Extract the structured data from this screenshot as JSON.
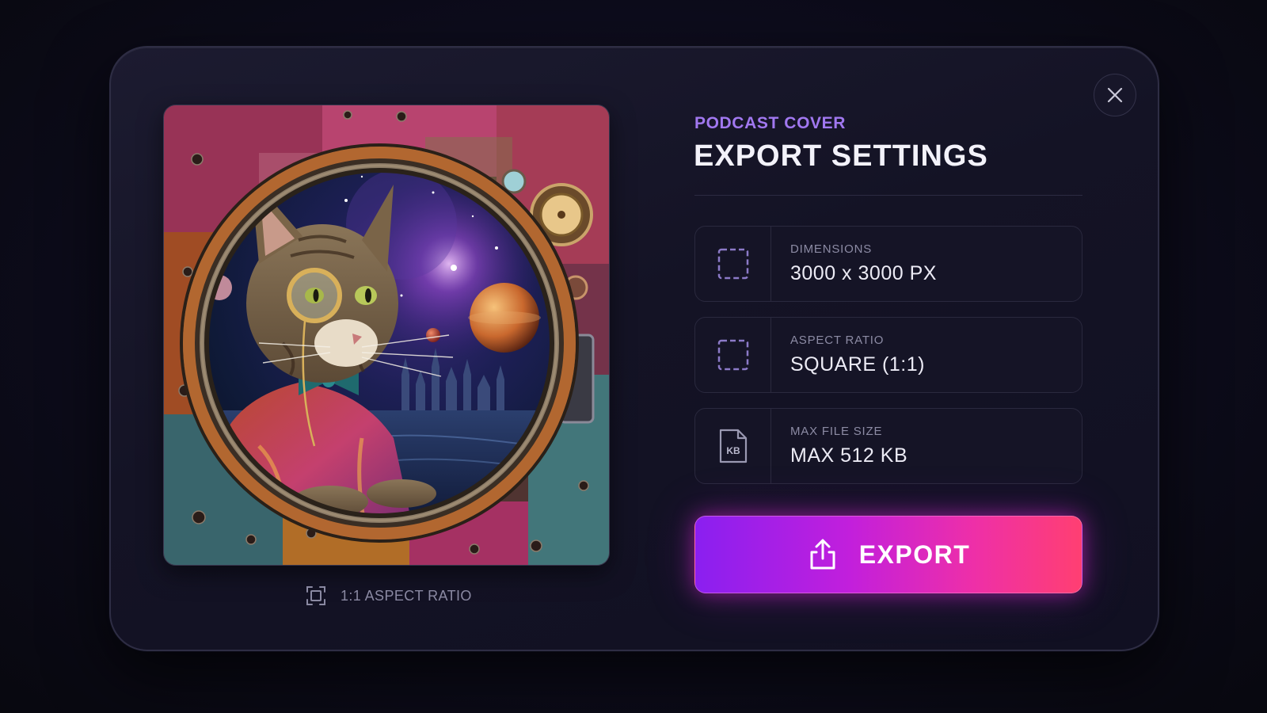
{
  "dialog": {
    "eyebrow": "PODCAST COVER",
    "title": "EXPORT SETTINGS",
    "close_icon": "close-icon"
  },
  "preview": {
    "caption": "1:1 ASPECT RATIO",
    "caption_icon": "aspect-ratio-icon",
    "image_description_icon": "cover-art-image"
  },
  "settings": [
    {
      "label": "DIMENSIONS",
      "value": "3000 x 3000 PX",
      "icon": "dashed-square-icon"
    },
    {
      "label": "ASPECT RATIO",
      "value": "SQUARE (1:1)",
      "icon": "dashed-square-icon"
    },
    {
      "label": "MAX FILE SIZE",
      "value": "MAX 512 KB",
      "icon": "kb-file-icon",
      "icon_text": "KB"
    }
  ],
  "export_button": {
    "label": "EXPORT",
    "icon": "share-upload-icon"
  },
  "colors": {
    "accent_purple": "#a178f0",
    "gradient_start": "#8a1ff0",
    "gradient_end": "#ff3f72",
    "background": "#0b0b16"
  }
}
